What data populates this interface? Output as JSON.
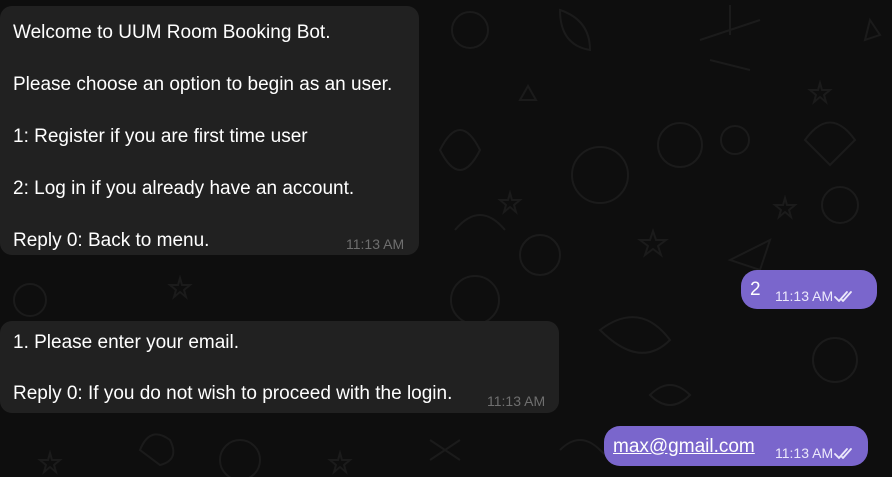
{
  "colors": {
    "background": "#0e0e0e",
    "incoming_bubble": "#212121",
    "outgoing_bubble": "#7a66cc",
    "incoming_time": "#6f6f6f",
    "outgoing_time": "#ece9fb"
  },
  "messages": [
    {
      "direction": "incoming",
      "lines": [
        "Welcome to UUM Room Booking Bot.",
        "Please choose an option to begin as an user.",
        "1: Register if you are first time user",
        "2: Log in if you already have an account.",
        "Reply 0: Back to menu."
      ],
      "time": "11:13 AM"
    },
    {
      "direction": "outgoing",
      "text": "2",
      "time": "11:13 AM",
      "status_icon": "double-check-icon"
    },
    {
      "direction": "incoming",
      "lines": [
        "1. Please enter your email.",
        "Reply 0: If you do not wish to proceed with the login."
      ],
      "time": "11:13 AM"
    },
    {
      "direction": "outgoing",
      "text": "max@gmail.com",
      "time": "11:13 AM",
      "status_icon": "double-check-icon"
    }
  ]
}
